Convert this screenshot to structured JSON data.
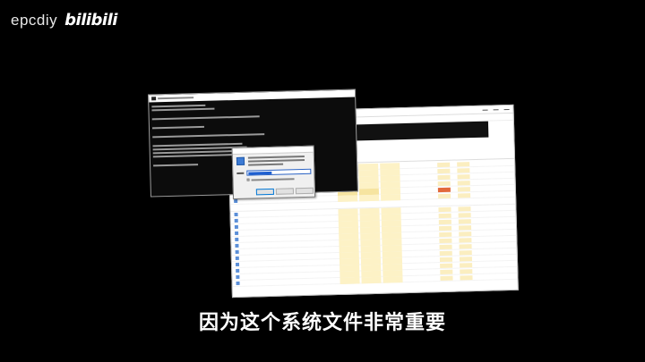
{
  "watermark": {
    "user": "epcdiy",
    "logo": "bilibili"
  },
  "subtitle": "因为这个系统文件非常重要",
  "colors": {
    "background": "#000000",
    "subtitle": "#ffffff",
    "highlight_cell": "#fdf2c6",
    "alert_cell": "#e2693c",
    "selection": "#1e5fd0"
  },
  "icons": {
    "run_dialog": "run-icon",
    "cmd_window": "cmd-icon"
  }
}
